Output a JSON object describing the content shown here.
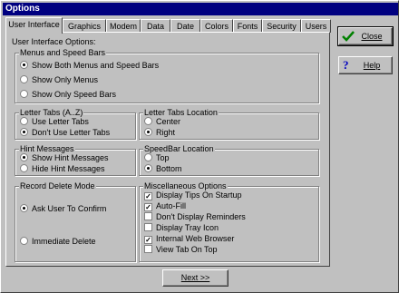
{
  "window": {
    "title": "Options"
  },
  "tabs": [
    "User Interface",
    "Graphics",
    "Modem",
    "Data",
    "Date",
    "Colors",
    "Fonts",
    "Security",
    "Users"
  ],
  "panel": {
    "title": "User Interface Options:",
    "menus_group": {
      "title": "Menus and Speed Bars",
      "options": [
        "Show Both Menus and Speed Bars",
        "Show Only Menus",
        "Show Only Speed Bars"
      ],
      "selected": 0
    },
    "letter_tabs": {
      "title": "Letter Tabs (A..Z)",
      "options": [
        "Use Letter Tabs",
        "Don't Use Letter Tabs"
      ],
      "selected": 1
    },
    "letter_tabs_location": {
      "title": "Letter Tabs Location",
      "options": [
        "Center",
        "Right"
      ],
      "selected": 1
    },
    "hint_messages": {
      "title": "Hint Messages",
      "options": [
        "Show Hint Messages",
        "Hide Hint Messages"
      ],
      "selected": 0
    },
    "speedbar_location": {
      "title": "SpeedBar Location",
      "options": [
        "Top",
        "Bottom"
      ],
      "selected": 1
    },
    "record_delete": {
      "title": "Record Delete Mode",
      "options": [
        "Ask User To Confirm",
        "Immediate Delete"
      ],
      "selected": 0
    },
    "misc": {
      "title": "Miscellaneous Options",
      "options": [
        {
          "label": "Display Tips On Startup",
          "checked": true
        },
        {
          "label": "Auto-Fill",
          "checked": true
        },
        {
          "label": "Don't Display Reminders",
          "checked": false
        },
        {
          "label": "Display Tray Icon",
          "checked": false
        },
        {
          "label": "Internal Web Browser",
          "checked": true
        },
        {
          "label": "View Tab On Top",
          "checked": false
        }
      ]
    }
  },
  "buttons": {
    "close": "Close",
    "help": "Help",
    "next": "Next >>"
  },
  "icons": {
    "close": "green-check-icon",
    "help": "blue-question-icon"
  }
}
